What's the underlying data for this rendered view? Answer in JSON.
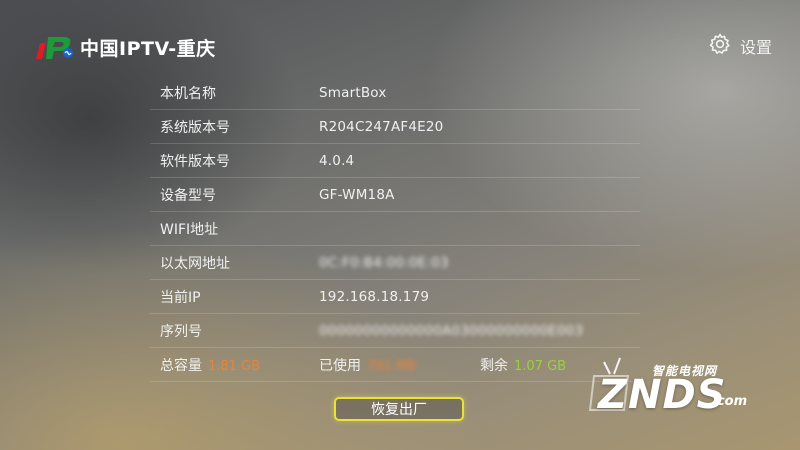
{
  "header": {
    "logo_text": "iP",
    "title": "中国IPTV-重庆"
  },
  "settings": {
    "label": "设置",
    "icon": "gear-icon"
  },
  "info": {
    "rows": [
      {
        "label": "本机名称",
        "value": "SmartBox"
      },
      {
        "label": "系统版本号",
        "value": "R204C247AF4E20"
      },
      {
        "label": "软件版本号",
        "value": "4.0.4"
      },
      {
        "label": "设备型号",
        "value": "GF-WM18A"
      },
      {
        "label": "WIFI地址",
        "value": ""
      },
      {
        "label": "以太网地址",
        "value": "0C:F0:B4:00:0E:03"
      },
      {
        "label": "当前IP",
        "value": "192.168.18.179"
      },
      {
        "label": "序列号",
        "value": "00000000000000A03000000000E003"
      }
    ],
    "storage": {
      "total_label": "总容量",
      "total_value": "1.81 GB",
      "used_label": "已使用",
      "used_value": "791 MB",
      "free_label": "剩余",
      "free_value": "1.07 GB"
    }
  },
  "actions": {
    "reset_label": "恢复出厂"
  },
  "watermark": {
    "brand": "ZNDS",
    "suffix": ".com",
    "tagline": "智能电视网"
  },
  "colors": {
    "total_value": "#e8843a",
    "used_value": "#e8843a",
    "free_value": "#9cd13a",
    "button_border": "#e8e23a"
  }
}
